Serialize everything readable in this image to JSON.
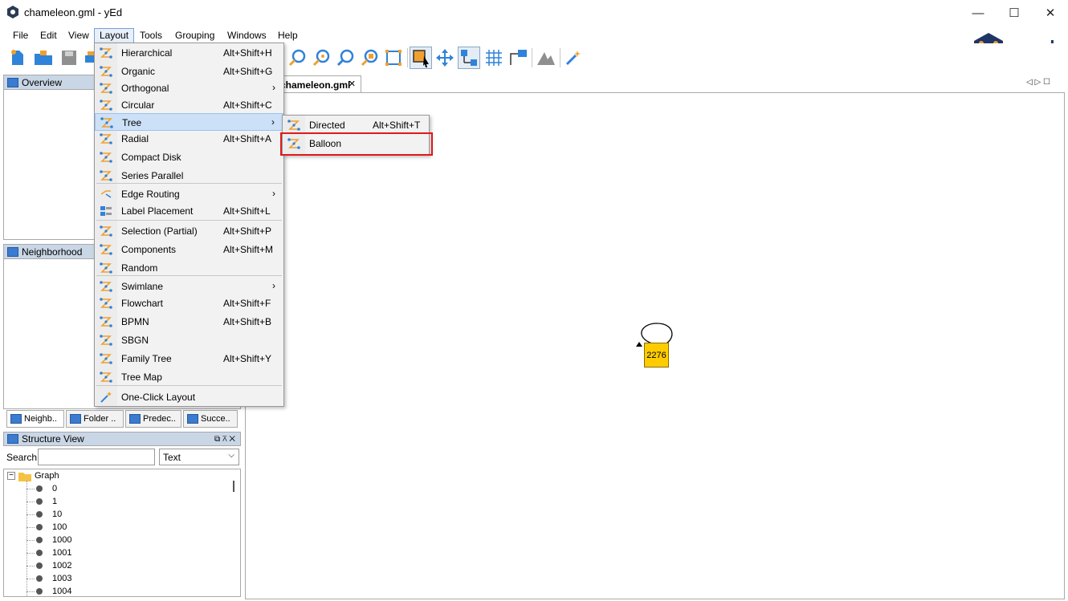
{
  "window": {
    "title": "chameleon.gml - yEd",
    "minimize": "—",
    "maximize": "☐",
    "close": "✕"
  },
  "menubar": [
    "File",
    "Edit",
    "View",
    "Layout",
    "Tools",
    "Grouping",
    "Windows",
    "Help"
  ],
  "logo": {
    "brand": "yworks"
  },
  "panels": {
    "overview": "Overview",
    "neighborhood": "Neighborhood",
    "tabs": [
      "Neighb..",
      "Folder ..",
      "Predec..",
      "Succe.."
    ],
    "structure": {
      "title": "Structure View",
      "search_label": "Search",
      "search_value": "",
      "select_value": "Text",
      "root": "Graph",
      "nodes": [
        "0",
        "1",
        "10",
        "100",
        "1000",
        "1001",
        "1002",
        "1003",
        "1004"
      ]
    }
  },
  "document_tab": "chameleon.gml",
  "layout_menu": [
    {
      "label": "Hierarchical",
      "accel": "Alt+Shift+H"
    },
    {
      "label": "Organic",
      "accel": "Alt+Shift+G"
    },
    {
      "label": "Orthogonal",
      "accel": "",
      "submenu": true
    },
    {
      "label": "Circular",
      "accel": "Alt+Shift+C"
    },
    {
      "label": "Tree",
      "accel": "",
      "submenu": true
    },
    {
      "label": "Radial",
      "accel": "Alt+Shift+A"
    },
    {
      "label": "Compact Disk",
      "accel": ""
    },
    {
      "label": "Series Parallel",
      "accel": ""
    },
    {
      "label": "Edge Routing",
      "accel": "",
      "submenu": true
    },
    {
      "label": "Label Placement",
      "accel": "Alt+Shift+L"
    },
    {
      "label": "Selection (Partial)",
      "accel": "Alt+Shift+P"
    },
    {
      "label": "Components",
      "accel": "Alt+Shift+M"
    },
    {
      "label": "Random",
      "accel": ""
    },
    {
      "label": "Swimlane",
      "accel": "",
      "submenu": true
    },
    {
      "label": "Flowchart",
      "accel": "Alt+Shift+F"
    },
    {
      "label": "BPMN",
      "accel": "Alt+Shift+B"
    },
    {
      "label": "SBGN",
      "accel": ""
    },
    {
      "label": "Family Tree",
      "accel": "Alt+Shift+Y"
    },
    {
      "label": "Tree Map",
      "accel": ""
    },
    {
      "label": "One-Click Layout",
      "accel": ""
    }
  ],
  "tree_submenu": [
    {
      "label": "Directed",
      "accel": "Alt+Shift+T"
    },
    {
      "label": "Balloon",
      "accel": ""
    }
  ],
  "graph": {
    "node_label": "2276"
  },
  "colors": {
    "accent": "#e01919",
    "node_fill": "#ffcc00",
    "brand_dark": "#1f3566",
    "brand_orange": "#f0a030"
  }
}
